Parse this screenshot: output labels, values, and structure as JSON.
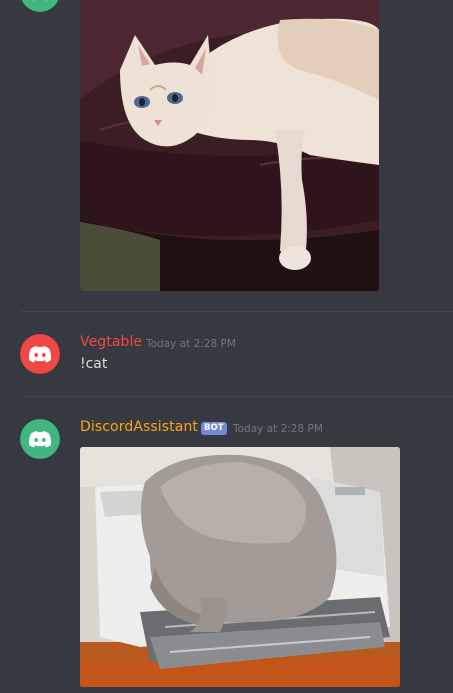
{
  "colors": {
    "background": "#36393f",
    "text": "#dcddde",
    "muted": "#72767d",
    "divider": "#42454a",
    "bot_color": "#faa61a",
    "bot_avatar": "#43b581",
    "user_avatar": "#f04747",
    "bot_tag": "#7289da"
  },
  "messages": [
    {
      "author": "",
      "author_color": "#43b581",
      "avatar": "discord-logo-green",
      "attachment": "cat-on-leather-couch-image"
    },
    {
      "author": "Vegtable",
      "author_color": "#f04747",
      "avatar": "discord-logo-red",
      "timestamp": "Today at 2:28 PM",
      "text": "!cat"
    },
    {
      "author": "DiscordAssistant",
      "author_color": "#faa61a",
      "avatar": "discord-logo-green",
      "bot_tag": "BOT",
      "timestamp": "Today at 2:28 PM",
      "attachment": "cat-on-printer-image"
    }
  ]
}
